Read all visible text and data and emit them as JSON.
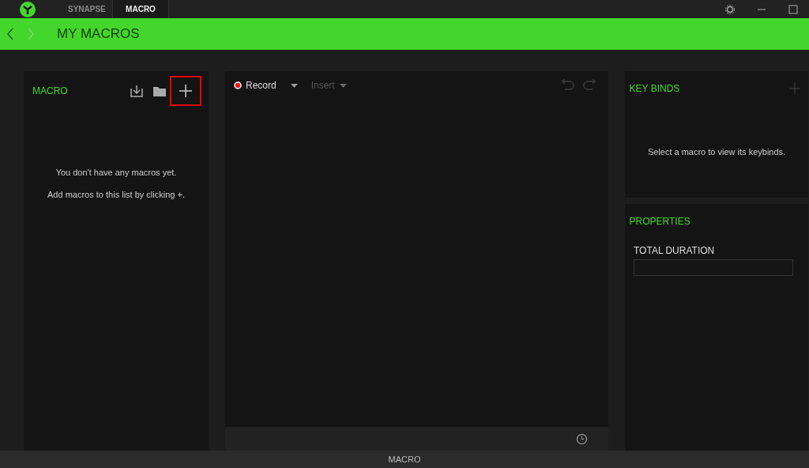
{
  "tabs": [
    {
      "label": "SYNAPSE",
      "selected": false
    },
    {
      "label": "MACRO",
      "selected": true
    }
  ],
  "header": {
    "title": "MY MACROS"
  },
  "macro_panel": {
    "title": "MACRO",
    "add_highlighted": true,
    "empty_lines": [
      "You don't have any macros yet.",
      "Add macros to this list by clicking +."
    ]
  },
  "editor": {
    "tools": [
      {
        "label": "Record",
        "kind": "record",
        "disabled": false
      },
      {
        "label": "Insert",
        "kind": "insert",
        "disabled": true
      }
    ],
    "undo_disabled": true,
    "redo_disabled": true
  },
  "keybinds": {
    "title": "KEY BINDS",
    "message": "Select a macro to view its keybinds."
  },
  "properties": {
    "title": "PROPERTIES",
    "field_label": "TOTAL DURATION"
  },
  "status_bar": {
    "text": "MACRO"
  }
}
